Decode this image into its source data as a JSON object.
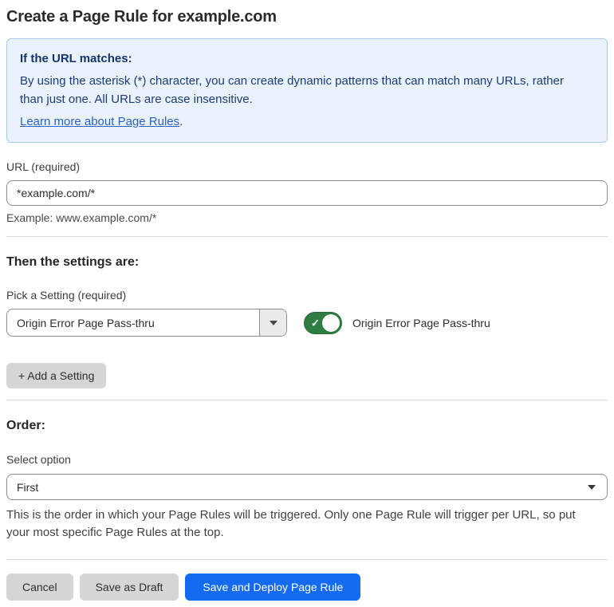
{
  "page": {
    "title": "Create a Page Rule for example.com"
  },
  "info_box": {
    "heading": "If the URL matches:",
    "body": "By using the asterisk (*) character, you can create dynamic patterns that can match many URLs, rather than just one. All URLs are case insensitive.",
    "link_label": "Learn more about Page Rules",
    "link_suffix": "."
  },
  "url_field": {
    "label": "URL (required)",
    "value": "*example.com/*",
    "helper": "Example: www.example.com/*"
  },
  "settings": {
    "heading": "Then the settings are:",
    "pick_label": "Pick a Setting (required)",
    "selected_setting": "Origin Error Page Pass-thru",
    "toggle": {
      "state": "on",
      "label": "Origin Error Page Pass-thru"
    },
    "add_button_label": "+ Add a Setting"
  },
  "order": {
    "heading": "Order:",
    "select_label": "Select option",
    "selected_option": "First",
    "helper": "This is the order in which your Page Rules will be triggered. Only one Page Rule will trigger per URL, so put your most specific Page Rules at the top."
  },
  "footer": {
    "cancel_label": "Cancel",
    "save_draft_label": "Save as Draft",
    "save_deploy_label": "Save and Deploy Page Rule"
  },
  "icons": {
    "toggle_check": "✓"
  },
  "colors": {
    "accent_blue": "#156bf0",
    "toggle_green": "#2e7d41",
    "info_bg": "#e9f2fd",
    "info_border": "#abc9ef",
    "info_text": "#1d3c78",
    "link_blue": "#2d63c8"
  }
}
